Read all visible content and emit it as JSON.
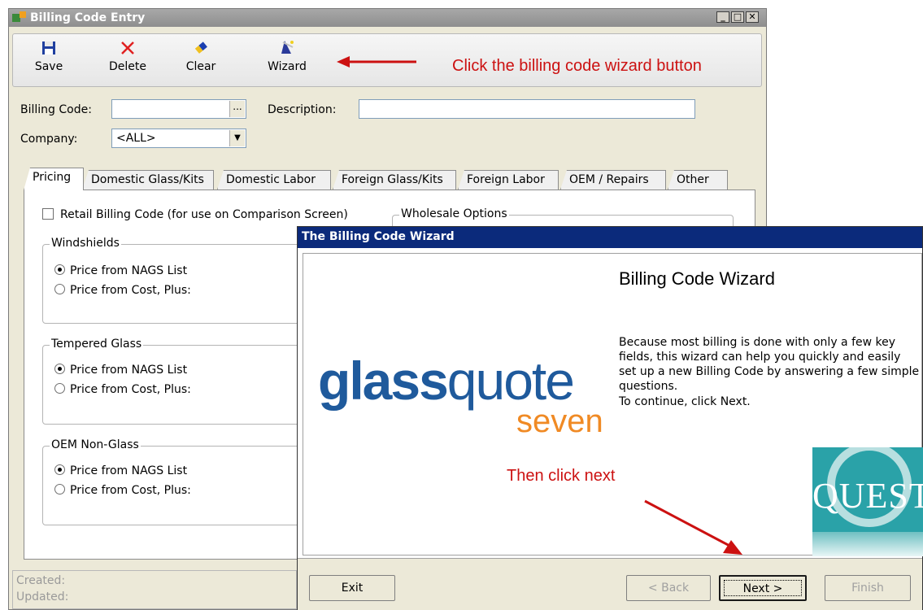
{
  "billing_window": {
    "title": "Billing Code Entry",
    "toolbar": [
      {
        "label": "Save",
        "icon": "floppy-disk-icon"
      },
      {
        "label": "Delete",
        "icon": "red-x-icon"
      },
      {
        "label": "Clear",
        "icon": "eraser-icon"
      },
      {
        "label": "Wizard",
        "icon": "wizard-wand-icon"
      }
    ],
    "annotation_wizard": "Click the billing code wizard button",
    "fields": {
      "billing_code_label": "Billing Code:",
      "billing_code_value": "",
      "browse_button": "...",
      "description_label": "Description:",
      "description_value": "",
      "company_label": "Company:",
      "company_value": "<ALL>"
    },
    "tabs": [
      "Pricing",
      "Domestic Glass/Kits",
      "Domestic Labor",
      "Foreign Glass/Kits",
      "Foreign Labor",
      "OEM / Repairs",
      "Other"
    ],
    "pricing": {
      "retail_checkbox": "Retail Billing Code (for use on Comparison Screen)",
      "wholesale_group": "Wholesale Options",
      "groups": [
        {
          "title": "Windshields",
          "options": [
            "Price from NAGS List",
            "Price from Cost, Plus:"
          ],
          "selected": 0
        },
        {
          "title": "Tempered Glass",
          "options": [
            "Price from NAGS List",
            "Price from Cost, Plus:"
          ],
          "selected": 0
        },
        {
          "title": "OEM Non-Glass",
          "options": [
            "Price from NAGS List",
            "Price from Cost, Plus:"
          ],
          "selected": 0
        }
      ]
    },
    "status": {
      "created": "Created:",
      "updated": "Updated:"
    }
  },
  "wizard": {
    "title": "The Billing Code Wizard",
    "heading": "Billing Code Wizard",
    "logo_glass": "glass",
    "logo_quote": "quote",
    "logo_seven": "seven",
    "body": "Because most billing is done with only a few key fields, this wizard can help you quickly and easily set up a new Billing Code by answering a few simple questions.",
    "continue": "To continue, click Next.",
    "quest_logo": "QUEST",
    "annotation_next": "Then click next",
    "buttons": {
      "exit": "Exit",
      "back": "< Back",
      "next": "Next >",
      "finish": "Finish"
    }
  },
  "colors": {
    "wizard_title": "#0b2a7b",
    "annotation": "#cc1111",
    "logo_blue": "#1f5a9c",
    "logo_orange": "#f08a24"
  }
}
